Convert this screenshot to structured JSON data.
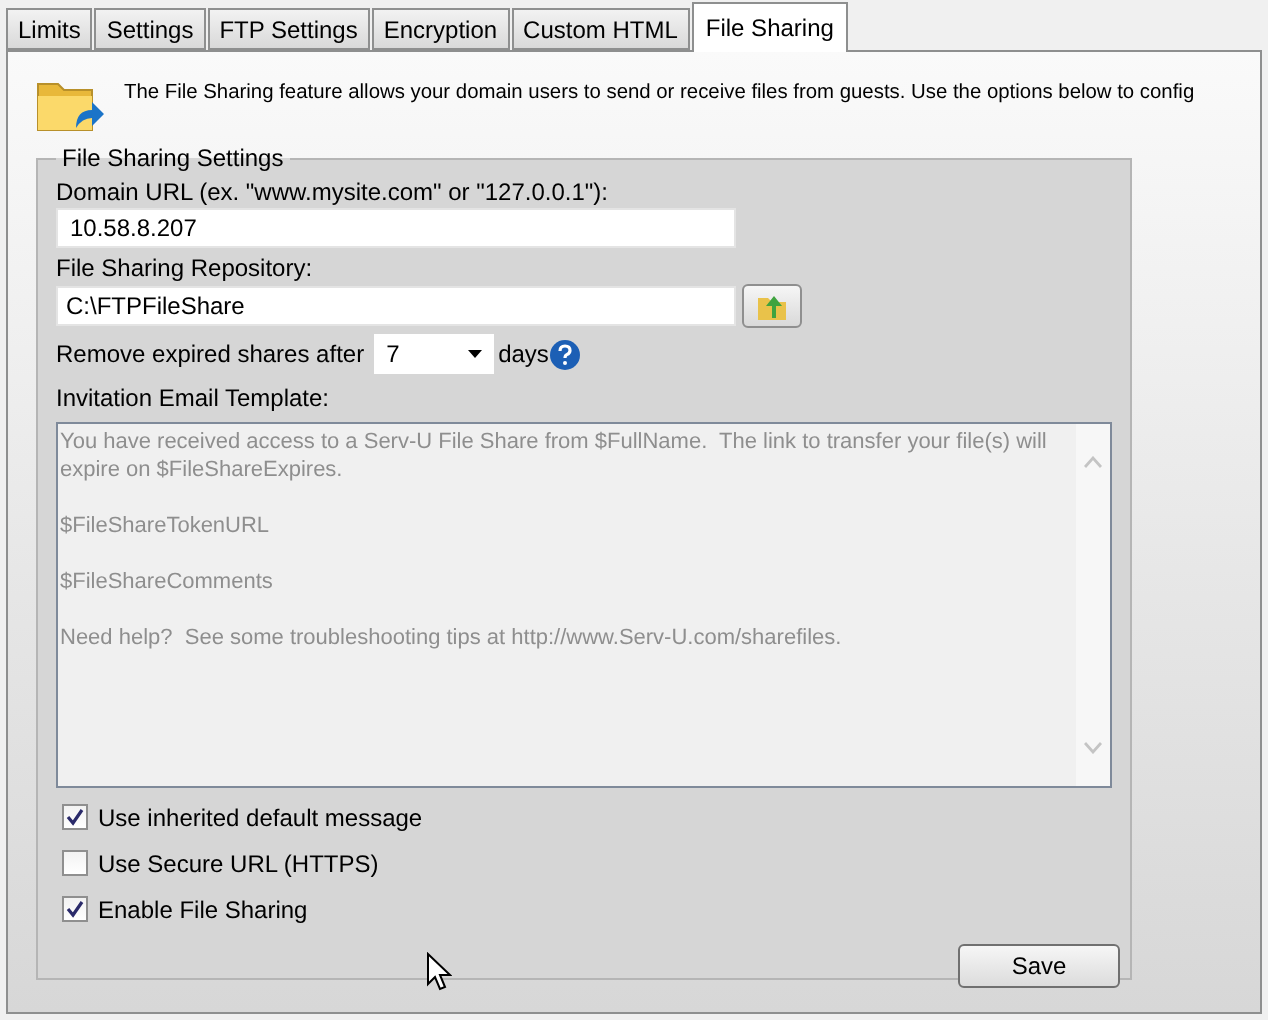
{
  "tabs": [
    {
      "label": "Limits",
      "selected": false
    },
    {
      "label": "Settings",
      "selected": false
    },
    {
      "label": "FTP Settings",
      "selected": false
    },
    {
      "label": "Encryption",
      "selected": false
    },
    {
      "label": "Custom HTML",
      "selected": false
    },
    {
      "label": "File Sharing",
      "selected": true
    }
  ],
  "intro": "The File Sharing feature allows your domain users to send or receive files from guests. Use the options below to config",
  "group": {
    "title": "File Sharing Settings",
    "domain_url": {
      "label": "Domain URL (ex. \"www.mysite.com\" or \"127.0.0.1\"):",
      "value": "10.58.8.207"
    },
    "repository": {
      "label": "File Sharing Repository:",
      "value": "C:\\FTPFileShare"
    },
    "expire": {
      "label": "Remove expired shares after",
      "value": "7",
      "unit": "days"
    },
    "template": {
      "label": "Invitation Email Template:",
      "disabled": true,
      "value": "You have received access to a Serv-U File Share from $FullName.  The link to transfer your file(s) will expire on $FileShareExpires.\n\n$FileShareTokenURL\n\n$FileShareComments\n\nNeed help?  See some troubleshooting tips at http://www.Serv-U.com/sharefiles."
    },
    "options": [
      {
        "label": "Use inherited default message",
        "checked": true
      },
      {
        "label": "Use Secure URL (HTTPS)",
        "checked": false
      },
      {
        "label": "Enable File Sharing",
        "checked": true
      }
    ],
    "save": "Save"
  }
}
